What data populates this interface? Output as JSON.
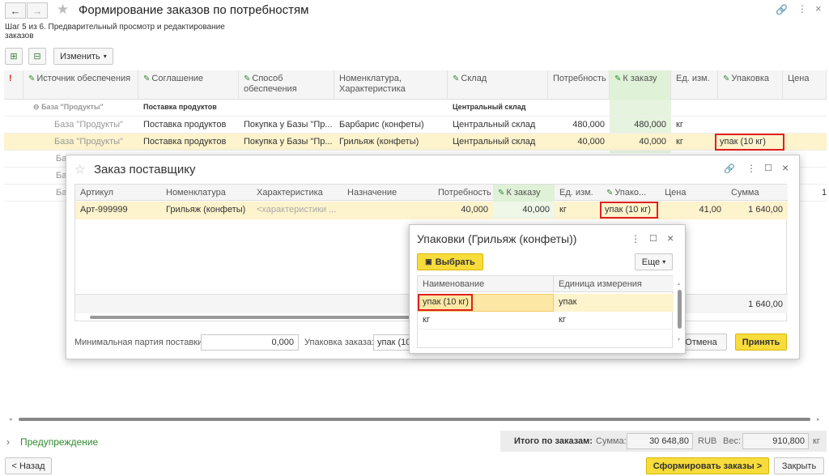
{
  "window": {
    "title": "Формирование заказов по потребностям",
    "step": "Шаг 5 из 6. Предварительный просмотр и редактирование заказов"
  },
  "toolbar": {
    "change_label": "Изменить"
  },
  "main_grid": {
    "headers": [
      "Источник обеспечения",
      "Соглашение",
      "Способ обеспечения",
      "Номенклатура, Характеристика",
      "Склад",
      "Потребность",
      "К заказу",
      "Ед. изм.",
      "Упаковка",
      "Цена"
    ],
    "group_row": {
      "source": "База \"Продукты\"",
      "agreement": "Поставка продуктов",
      "warehouse": "Центральный склад"
    },
    "rows": [
      {
        "source": "База \"Продукты\"",
        "agreement": "Поставка продуктов",
        "method": "Покупка у Базы \"Пр...",
        "item": "Барбарис (конфеты)",
        "warehouse": "Центральный склад",
        "need": "480,000",
        "order": "480,000",
        "unit": "кг",
        "pack": ""
      },
      {
        "source": "База \"Продукты\"",
        "agreement": "Поставка продуктов",
        "method": "Покупка у Базы \"Пр...",
        "item": "Грильяж (конфеты)",
        "warehouse": "Центральный склад",
        "need": "40,000",
        "order": "40,000",
        "unit": "кг",
        "pack": "упак (10 кг)"
      }
    ],
    "hidden_rows": [
      "Ба",
      "Ба",
      "Ба"
    ],
    "right_fragment": "1"
  },
  "dialog": {
    "title": "Заказ поставщику",
    "headers": [
      "Артикул",
      "Номенклатура",
      "Характеристика",
      "Назначение",
      "Потребность",
      "К заказу",
      "Ед. изм.",
      "Упако...",
      "Цена",
      "Сумма"
    ],
    "row": {
      "article": "Арт-999999",
      "item": "Грильяж (конфеты)",
      "char": "<характеристики ...",
      "purpose": "",
      "need": "40,000",
      "order": "40,000",
      "unit": "кг",
      "pack": "упак (10 кг)",
      "price": "41,00",
      "sum": "1 640,00"
    },
    "total_sum": "1 640,00",
    "min_batch_label": "Минимальная партия поставки:",
    "min_batch_value": "0,000",
    "pack_label": "Упаковка заказа:",
    "pack_value": "упак (10",
    "cancel": "Отмена",
    "accept": "Принять"
  },
  "popup": {
    "title": "Упаковки (Грильяж (конфеты))",
    "select": "Выбрать",
    "more": "Еще",
    "headers": [
      "Наименование",
      "Единица измерения"
    ],
    "rows": [
      {
        "name": "упак (10 кг)",
        "unit": "упак"
      },
      {
        "name": "кг",
        "unit": "кг"
      }
    ]
  },
  "footer": {
    "warning": "Предупреждение",
    "totals_label": "Итого по заказам:",
    "sum_label": "Сумма:",
    "sum_value": "30 648,80",
    "currency": "RUB",
    "weight_label": "Вес:",
    "weight_value": "910,800",
    "weight_unit": "кг",
    "back": "< Назад",
    "create": "Сформировать заказы >",
    "close": "Закрыть"
  },
  "colors": {
    "accent_yellow": "#f7dc3c",
    "selected_row": "#fdf3cc",
    "green": "#2f8a2f",
    "red_outline": "#e02020"
  }
}
